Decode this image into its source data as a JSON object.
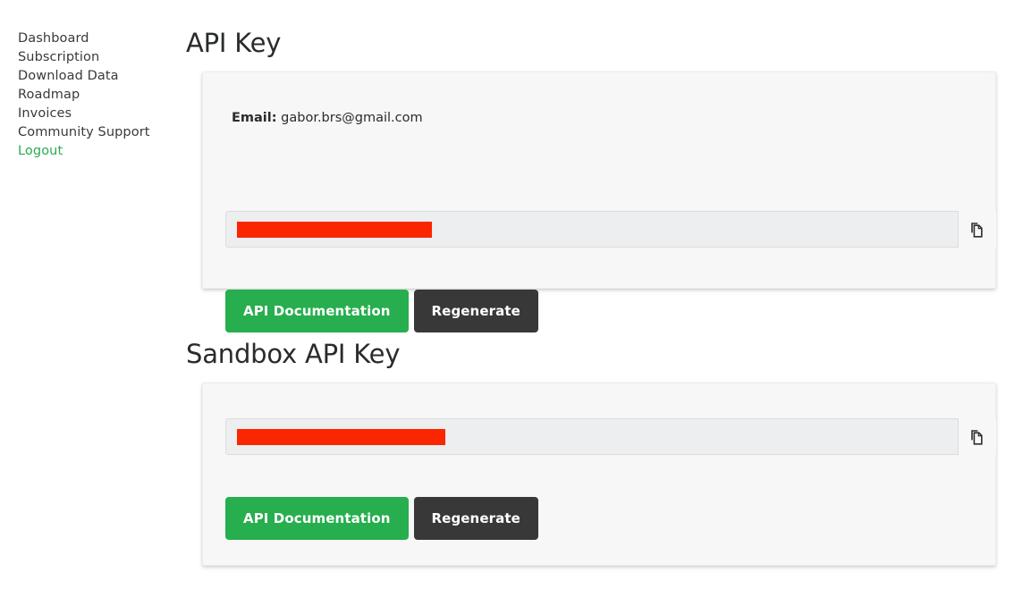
{
  "sidebar": {
    "items": [
      {
        "label": "Dashboard",
        "name": "dashboard"
      },
      {
        "label": "Subscription",
        "name": "subscription"
      },
      {
        "label": "Download Data",
        "name": "download-data"
      },
      {
        "label": "Roadmap",
        "name": "roadmap"
      },
      {
        "label": "Invoices",
        "name": "invoices"
      },
      {
        "label": "Community Support",
        "name": "community-support"
      },
      {
        "label": "Logout",
        "name": "logout"
      }
    ]
  },
  "colors": {
    "brand_green": "#27ae4e",
    "logout_green": "#2aab4f",
    "regenerate_dark": "#383838",
    "redaction_red": "#fa2600",
    "card_background": "#f7f7f7",
    "input_background": "#eceeef",
    "text": "#373a3c"
  },
  "api_key_section": {
    "title": "API Key",
    "email_label": "Email:",
    "email_value": "gabor.brs@gmail.com",
    "key_value": "",
    "key_placeholder": "",
    "copy_icon": "copy-icon",
    "documentation_label": "API Documentation",
    "regenerate_label": "Regenerate"
  },
  "sandbox_api_key_section": {
    "title": "Sandbox API Key",
    "key_value": "",
    "key_placeholder": "",
    "copy_icon": "copy-icon",
    "documentation_label": "API Documentation",
    "regenerate_label": "Regenerate"
  }
}
